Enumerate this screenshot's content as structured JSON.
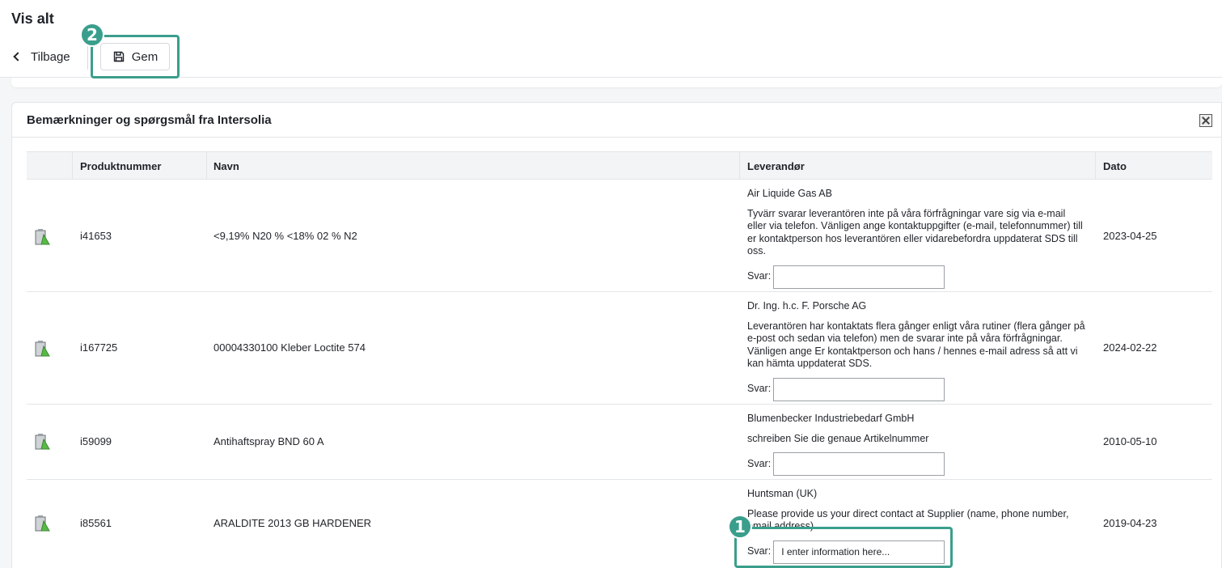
{
  "header": {
    "title": "Vis alt",
    "back_label": "Tilbage",
    "save_label": "Gem"
  },
  "panel": {
    "title": "Bemærkninger og spørgsmål fra Intersolia"
  },
  "table": {
    "columns": [
      "Produktnummer",
      "Navn",
      "Leverandør",
      "Dato"
    ],
    "rows": [
      {
        "product_number": "i41653",
        "name": "<9,19% N20 % <18% 02 % N2",
        "supplier": "Air Liquide Gas AB",
        "message": "Tyvärr svarar leverantören inte på våra förfrågningar vare sig via e-mail eller via telefon. Vänligen ange kontaktuppgifter (e-mail, telefonnummer) till er kontaktperson hos leverantören eller vidarebefordra uppdaterat SDS till oss.",
        "reply_label": "Svar:",
        "reply_value": "",
        "date": "2023-04-25"
      },
      {
        "product_number": "i167725",
        "name": "00004330100 Kleber Loctite 574",
        "supplier": "Dr. Ing. h.c. F. Porsche AG",
        "message": "Leverantören har kontaktats flera gånger enligt våra rutiner (flera gånger på e-post och sedan via telefon) men de svarar inte på våra förfrågningar. Vänligen ange Er kontaktperson och hans / hennes e-mail adress så att vi kan hämta uppdaterat SDS.",
        "reply_label": "Svar:",
        "reply_value": "",
        "date": "2024-02-22"
      },
      {
        "product_number": "i59099",
        "name": "Antihaftspray BND 60 A",
        "supplier": "Blumenbecker Industriebedarf GmbH",
        "message": "schreiben Sie die genaue Artikelnummer",
        "reply_label": "Svar:",
        "reply_value": "",
        "date": "2010-05-10"
      },
      {
        "product_number": "i85561",
        "name": "ARALDITE 2013 GB HARDENER",
        "supplier": "Huntsman (UK)",
        "message": "Please provide us your direct contact at Supplier (name, phone number, email address).",
        "reply_label": "Svar:",
        "reply_value": "I enter information here...",
        "date": "2019-04-23"
      }
    ]
  },
  "annotations": {
    "badge_1": "1",
    "badge_2": "2",
    "color": "#3a9e8c"
  },
  "icons": {
    "back": "chevron-left-icon",
    "save": "floppy-disk-icon",
    "export": "excel-export-icon",
    "row": "product-flask-icon"
  }
}
